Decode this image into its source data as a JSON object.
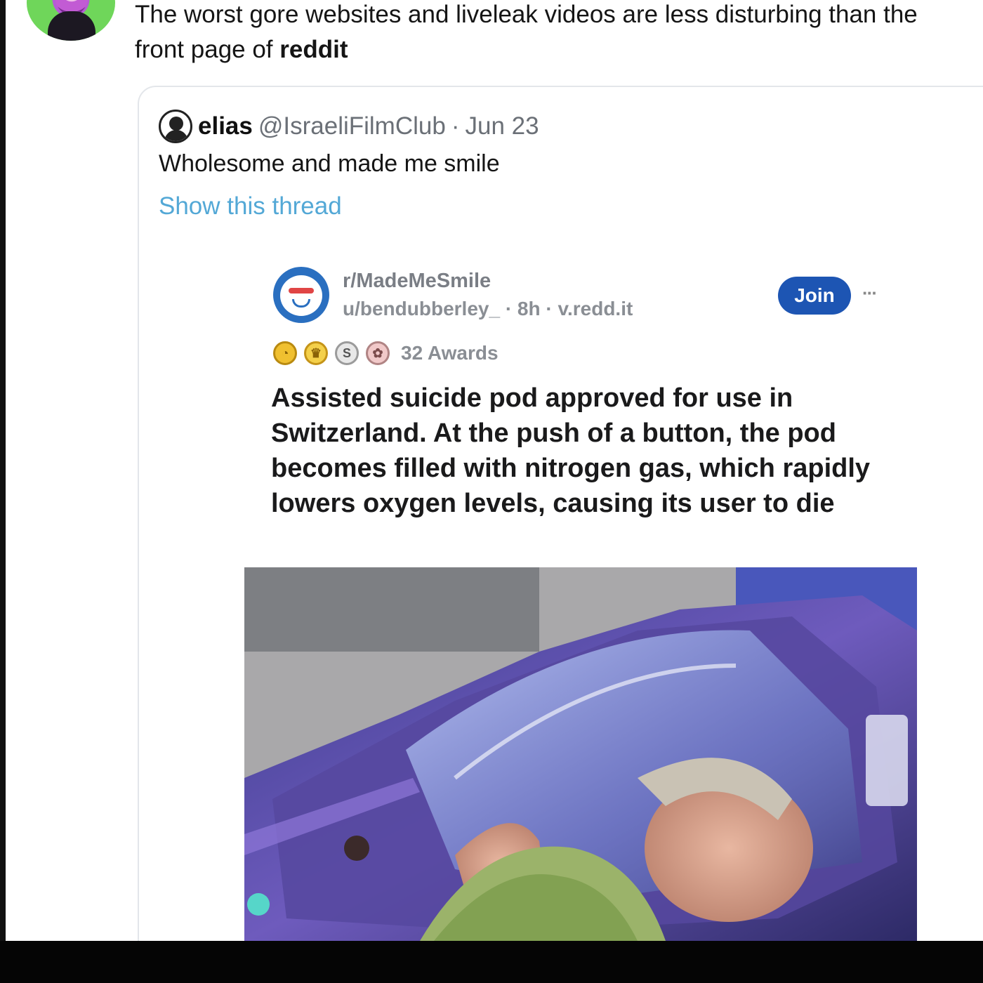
{
  "main_tweet": {
    "text_line1": "The worst gore websites and liveleak videos are less disturbing than the",
    "text_line2_prefix": "front page of ",
    "text_line2_bold": "reddit"
  },
  "quoted_tweet": {
    "display_name": "elias",
    "handle": "@IsraeliFilmClub",
    "separator": "·",
    "date": "Jun 23",
    "body": "Wholesome and made me smile",
    "show_thread_label": "Show this thread"
  },
  "reddit_post": {
    "subreddit": "r/MadeMeSmile",
    "byline": "u/bendubberley_ · 8h · v.redd.it",
    "join_label": "Join",
    "more_label": "···",
    "awards_label": "32 Awards",
    "award_icons": [
      "gold-award-icon",
      "crown-award-icon",
      "silver-award-icon",
      "brain-award-icon"
    ],
    "title": "Assisted suicide pod approved for use in Switzerland. At the push of a button, the pod becomes filled with nitrogen gas, which rapidly lowers oxygen levels, causing its user to die"
  },
  "colors": {
    "link": "#53a8d6",
    "join_button": "#1d55b3",
    "meta_gray": "#6b7077"
  }
}
